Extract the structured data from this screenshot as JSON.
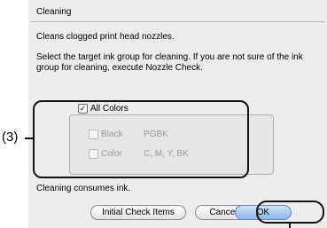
{
  "dialog": {
    "title": "Cleaning",
    "description": "Cleans clogged print head nozzles.",
    "instruction": "Select the target ink group for cleaning. If you are not sure of the ink group for cleaning, execute Nozzle Check.",
    "all_colors": {
      "label": "All Colors",
      "checked": true
    },
    "options": [
      {
        "label": "Black",
        "value": "PGBK",
        "checked": false,
        "enabled": false
      },
      {
        "label": "Color",
        "value": "C, M, Y, BK",
        "checked": false,
        "enabled": false
      }
    ],
    "note": "Cleaning consumes ink.",
    "buttons": {
      "initial": "Initial Check Items",
      "cancel": "Cancel",
      "ok": "OK"
    }
  },
  "callouts": {
    "label": "(3)"
  },
  "colors": {
    "ok_button": "#8fb6ec",
    "dialog_bg": "#ececec"
  }
}
